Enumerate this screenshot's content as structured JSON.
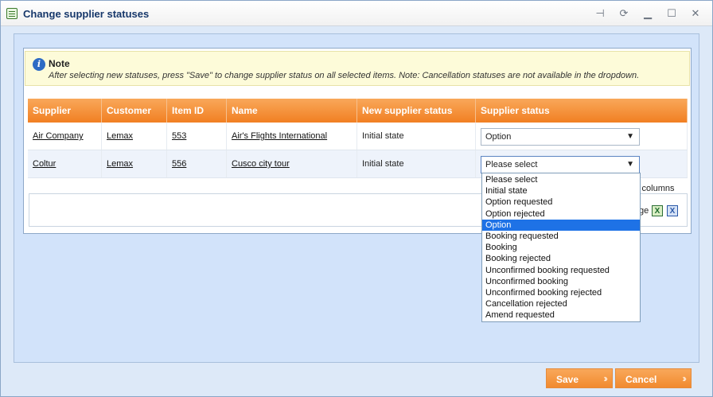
{
  "window": {
    "title": "Change supplier statuses",
    "icons": [
      "pin-icon",
      "refresh-icon",
      "minimize-icon",
      "maximize-icon",
      "close-icon"
    ]
  },
  "note": {
    "title": "Note",
    "text": "After selecting new statuses, press \"Save\" to change supplier status on all selected items. Note: Cancellation statuses are not available in the dropdown."
  },
  "table": {
    "headers": [
      "Supplier",
      "Customer",
      "Item ID",
      "Name",
      "New supplier status",
      "Supplier status"
    ],
    "rows": [
      {
        "supplier": "Air Company",
        "customer": "Lemax",
        "item_id": "553",
        "name": "Air's Flights International",
        "new_status": "Initial state",
        "status": "Option"
      },
      {
        "supplier": "Coltur",
        "customer": "Lemax",
        "item_id": "556",
        "name": "Cusco city tour",
        "new_status": "Initial state",
        "status": "Please select"
      }
    ]
  },
  "grid_footer": {
    "edit_columns": "it columns",
    "page_label": "ge"
  },
  "dropdown": {
    "options": [
      "Please select",
      "Initial state",
      "Option requested",
      "Option rejected",
      "Option",
      "Booking requested",
      "Booking",
      "Booking rejected",
      "Unconfirmed booking requested",
      "Unconfirmed booking",
      "Unconfirmed booking rejected",
      "Cancellation rejected",
      "Amend requested"
    ],
    "highlighted": "Option"
  },
  "buttons": {
    "save": "Save",
    "cancel": "Cancel"
  },
  "colors": {
    "header_orange": "#f17f22",
    "highlight_blue": "#1e72e6",
    "title_blue": "#17386b"
  }
}
